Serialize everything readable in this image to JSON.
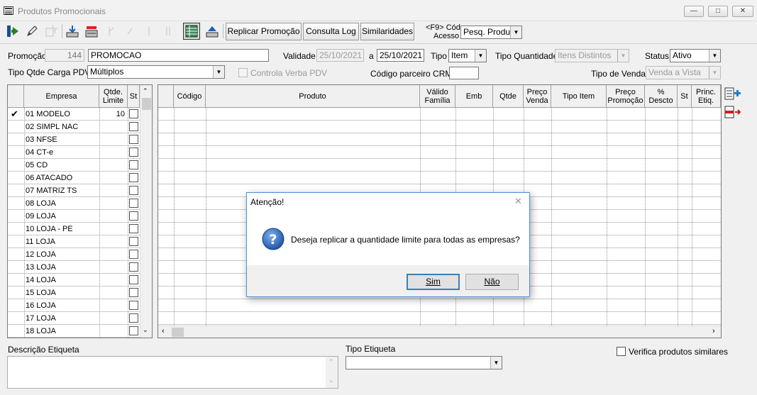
{
  "window": {
    "title": "Produtos Promocionais"
  },
  "toolbar": {
    "replicar_label": "Replicar Promoção",
    "consulta_log_label": "Consulta Log",
    "similaridades_label": "Similaridades",
    "f9_label": "<F9> Cód",
    "acesso_label": "Acesso",
    "pesquisa_value": "Pesq. Produtc"
  },
  "form": {
    "promocao_label": "Promoção",
    "promocao_codigo": "144",
    "promocao_nome": "PROMOCAO",
    "validade_label": "Validade",
    "validade_inicio": "25/10/2021",
    "validade_a": "a",
    "validade_fim": "25/10/2021",
    "tipo_label": "Tipo",
    "tipo_value": "Item",
    "tipo_quantidade_label": "Tipo Quantidade",
    "tipo_quantidade_value": "Itens Distintos",
    "status_label": "Status",
    "status_value": "Ativo",
    "tipo_qtde_carga_label": "Tipo Qtde Carga PDV",
    "tipo_qtde_carga_value": "Múltiplos",
    "controla_verba_label": "Controla Verba PDV",
    "codigo_parceiro_label": "Código parceiro CRM",
    "codigo_parceiro_value": "",
    "tipo_venda_label": "Tipo de Venda",
    "tipo_venda_value": "Venda a Vista"
  },
  "empresas_grid": {
    "headers": {
      "empresa": "Empresa",
      "qtde_limite": "Qtde. Limite",
      "st": "St"
    },
    "rows": [
      {
        "empresa": "01 MODELO",
        "qtde": "10",
        "checked": true
      },
      {
        "empresa": "02 SIMPL NAC",
        "qtde": ""
      },
      {
        "empresa": "03 NFSE",
        "qtde": ""
      },
      {
        "empresa": "04 CT-e",
        "qtde": ""
      },
      {
        "empresa": "05 CD",
        "qtde": ""
      },
      {
        "empresa": "06 ATACADO",
        "qtde": ""
      },
      {
        "empresa": "07 MATRIZ TS",
        "qtde": ""
      },
      {
        "empresa": "08 LOJA",
        "qtde": ""
      },
      {
        "empresa": "09 LOJA",
        "qtde": ""
      },
      {
        "empresa": "10 LOJA - PE",
        "qtde": ""
      },
      {
        "empresa": "11 LOJA",
        "qtde": ""
      },
      {
        "empresa": "12 LOJA",
        "qtde": ""
      },
      {
        "empresa": "13 LOJA",
        "qtde": ""
      },
      {
        "empresa": "14 LOJA",
        "qtde": ""
      },
      {
        "empresa": "15 LOJA",
        "qtde": ""
      },
      {
        "empresa": "16 LOJA",
        "qtde": ""
      },
      {
        "empresa": "17 LOJA",
        "qtde": ""
      },
      {
        "empresa": "18 LOJA",
        "qtde": ""
      }
    ]
  },
  "produtos_grid": {
    "headers": [
      "Código",
      "Produto",
      "Válido Família",
      "Emb",
      "Qtde",
      "Preço Venda",
      "Tipo Item",
      "Preço Promoção",
      "% Descto",
      "St",
      "Princ. Etiq."
    ]
  },
  "bottom": {
    "descricao_etiqueta_label": "Descrição Etiqueta",
    "tipo_etiqueta_label": "Tipo Etiqueta",
    "tipo_etiqueta_value": "",
    "verifica_similares_label": "Verifica produtos similares"
  },
  "dialog": {
    "title": "Atenção!",
    "message": "Deseja replicar a quantidade limite para todas as empresas?",
    "sim_label": "Sim",
    "nao_label": "Não"
  },
  "colors": {
    "dialog_border": "#4a90d9",
    "question_icon": "#2b5ea7",
    "add_icon": "#1f7fc9",
    "remove_icon": "#d11c1c"
  }
}
